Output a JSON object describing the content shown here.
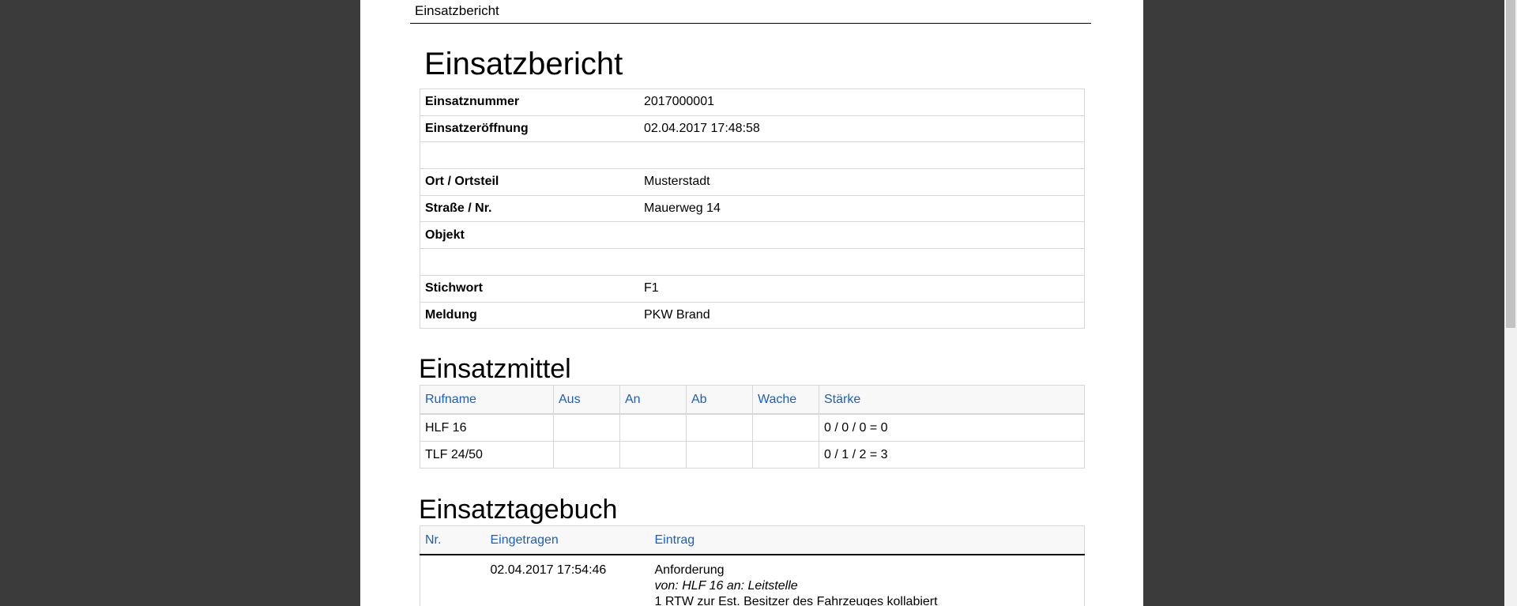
{
  "header": {
    "running_title": "Einsatzbericht"
  },
  "report": {
    "title": "Einsatzbericht",
    "rows": [
      {
        "label": "Einsatznummer",
        "value": "2017000001"
      },
      {
        "label": "Einsatzeröffnung",
        "value": "02.04.2017 17:48:58"
      },
      {
        "label": "",
        "value": ""
      },
      {
        "label": "Ort / Ortsteil",
        "value": "Musterstadt"
      },
      {
        "label": "Straße / Nr.",
        "value": "Mauerweg  14"
      },
      {
        "label": "Objekt",
        "value": ""
      },
      {
        "label": "",
        "value": ""
      },
      {
        "label": "Stichwort",
        "value": "F1"
      },
      {
        "label": "Meldung",
        "value": "PKW Brand"
      }
    ]
  },
  "einsatzmittel": {
    "title": "Einsatzmittel",
    "columns": [
      "Rufname",
      "Aus",
      "An",
      "Ab",
      "Wache",
      "Stärke"
    ],
    "rows": [
      [
        "HLF 16",
        "",
        "",
        "",
        "",
        "0 / 0 / 0 = 0"
      ],
      [
        "TLF 24/50",
        "",
        "",
        "",
        "",
        "0 / 1 / 2 = 3"
      ]
    ]
  },
  "einsatztagebuch": {
    "title": "Einsatztagebuch",
    "columns": [
      "Nr.",
      "Eingetragen",
      "Eintrag"
    ],
    "entries": [
      {
        "nr": "",
        "time": "02.04.2017 17:54:46",
        "title": "Anforderung",
        "meta": "von: HLF 16 an: Leitstelle",
        "text": "1 RTW zur Est. Besitzer des Fahrzeuges kollabiert"
      }
    ]
  }
}
